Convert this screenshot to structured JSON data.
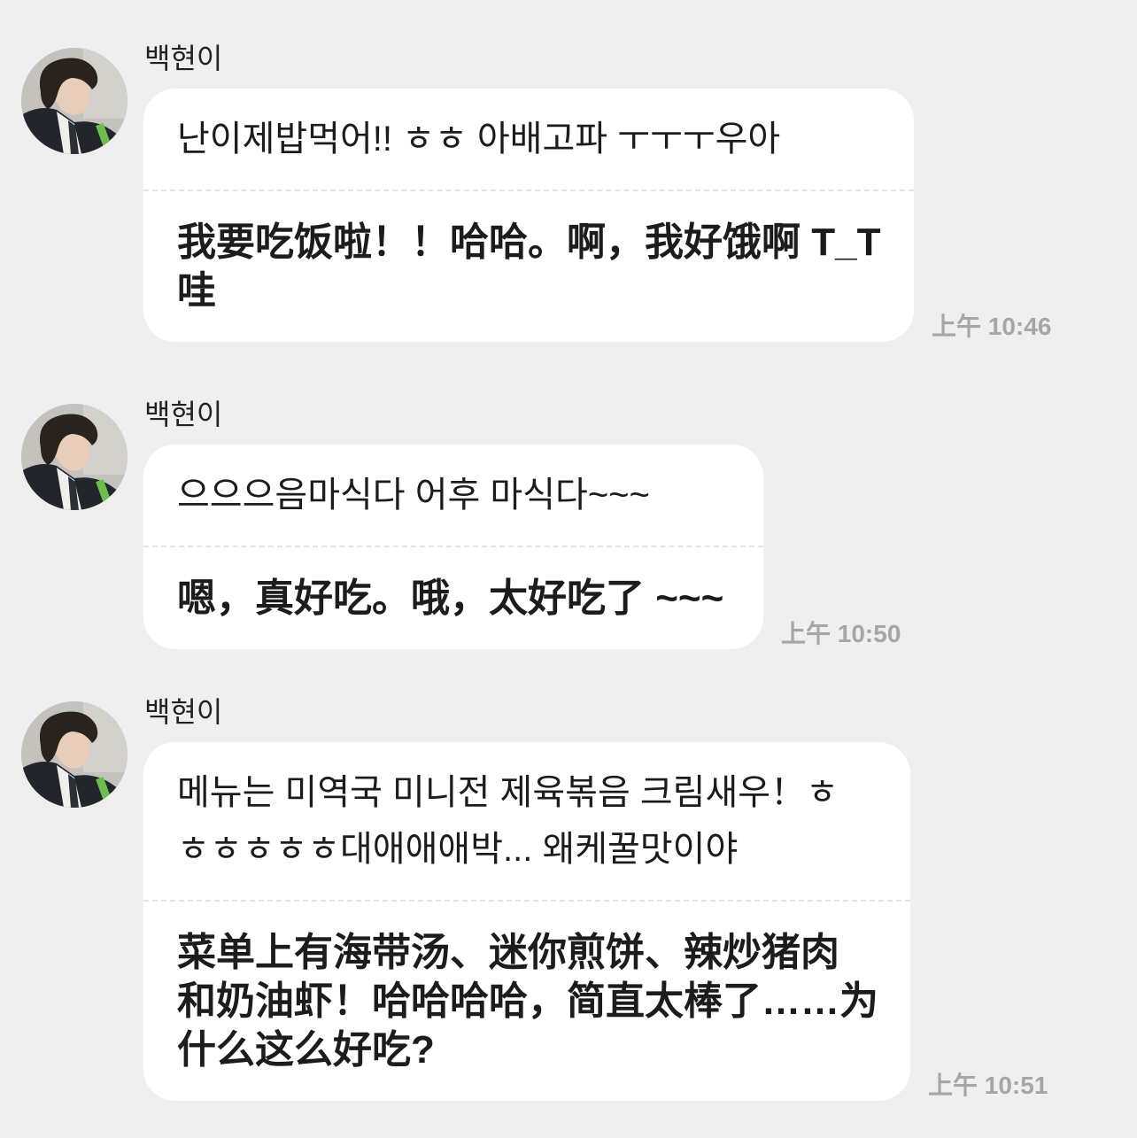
{
  "colors": {
    "background": "#efefef",
    "bubble": "#ffffff",
    "text": "#1c1c1c",
    "name": "#222222",
    "time": "#a6a6a6",
    "divider": "#e4e4e4"
  },
  "messages": [
    {
      "sender": "백현이",
      "original_lines": [
        "난이제밥먹어!! ㅎㅎ 아배고파 ㅜㅜㅜ우아"
      ],
      "translation_lines": [
        "我要吃饭啦！！哈哈。啊，我好饿啊 T_T",
        "哇"
      ],
      "time": "上午 10:46"
    },
    {
      "sender": "백현이",
      "original_lines": [
        "으으으음마식다 어후 마식다~~~"
      ],
      "translation_lines": [
        "嗯，真好吃。哦，太好吃了 ~~~"
      ],
      "time": "上午 10:50"
    },
    {
      "sender": "백현이",
      "original_lines": [
        "메뉴는 미역국 미니전 제육볶음 크림새우！ㅎ",
        "ㅎㅎㅎㅎㅎ대애애애박... 왜케꿀맛이야"
      ],
      "translation_lines": [
        "菜单上有海带汤、迷你煎饼、辣炒猪肉",
        "和奶油虾！哈哈哈哈，简直太棒了……为",
        "什么这么好吃?"
      ],
      "time": "上午 10:51"
    }
  ]
}
